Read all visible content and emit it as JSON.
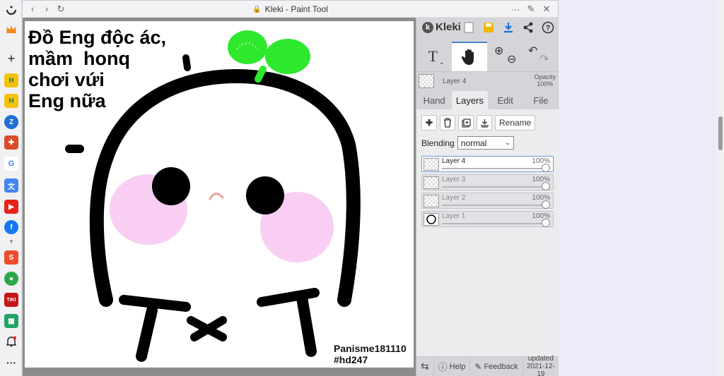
{
  "window": {
    "title": "Kleki - Paint Tool"
  },
  "canvas": {
    "text_lines": [
      "Đồ Eng độc ác,",
      "mầm  honq",
      "chơi vứi",
      "Eng nữa"
    ],
    "watermark": [
      "Panisme181110",
      "#hd247"
    ]
  },
  "panel": {
    "brand": "Kleki",
    "current_layer": {
      "name": "Layer 4",
      "opacity_label": "Opacity",
      "opacity_value": "100%"
    },
    "tabs": [
      "Hand",
      "Layers",
      "Edit",
      "File"
    ],
    "active_tab": "Layers",
    "rename_label": "Rename",
    "blending_label": "Blending",
    "blending_value": "normal",
    "layers": [
      {
        "name": "Layer 4",
        "opacity": "100%",
        "selected": true
      },
      {
        "name": "Layer 3",
        "opacity": "100%",
        "selected": false
      },
      {
        "name": "Layer 2",
        "opacity": "100%",
        "selected": false
      },
      {
        "name": "Layer 1",
        "opacity": "100%",
        "selected": false
      }
    ],
    "footer": {
      "help": "Help",
      "feedback": "Feedback",
      "updated_label": "updated",
      "updated_date": "2021-12-19"
    }
  },
  "icons": {
    "text_tool": "text-tool-icon",
    "hand_tool": "hand-tool-icon",
    "zoom_in": "zoom-in-icon",
    "zoom_out": "zoom-out-icon",
    "undo": "undo-icon",
    "redo": "redo-icon"
  },
  "colors": {
    "accent": "#4a7fd0",
    "sprout": "#2ee82e",
    "blush": "#f7c6f0"
  }
}
